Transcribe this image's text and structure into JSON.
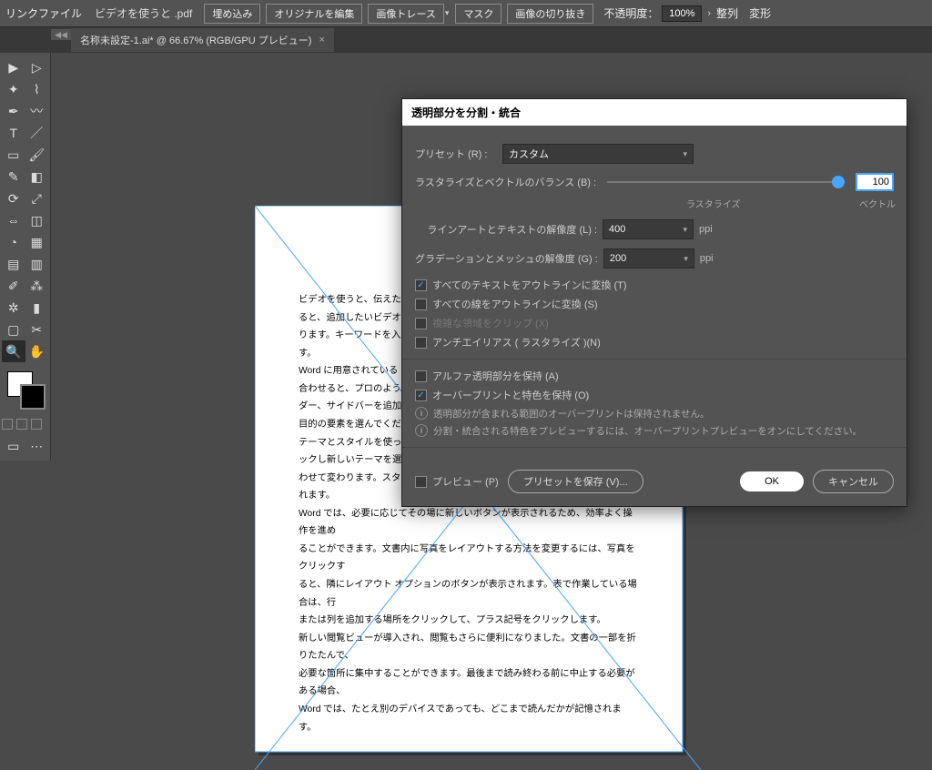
{
  "topbar": {
    "link_file": "リンクファイル",
    "filename": "ビデオを使うと .pdf",
    "embed": "埋め込み",
    "edit_original": "オリジナルを編集",
    "image_trace": "画像トレース",
    "mask": "マスク",
    "crop_image": "画像の切り抜き",
    "opacity_label": "不透明度：",
    "opacity_value": "100%",
    "align": "整列",
    "transform": "変形"
  },
  "tab": {
    "title": "名称未設定-1.ai* @ 66.67% (RGB/GPU プレビュー)"
  },
  "page_text": {
    "l1": "ビデオを使うと、伝えたい",
    "l2": "ると、追加したいビデオを",
    "l3": "ります。キーワードを入力",
    "l4": "す。",
    "l5": "Word に用意されている",
    "l6": "合わせると、プロのような",
    "l7": "ダー、サイドバーを追加",
    "l8": "目的の要素を選んでくだ",
    "l9": "テーマとスタイルを使っ",
    "l10": "ックし新しいテーマを選",
    "l11": "わせて変わります。スタ",
    "l12": "れます。",
    "l13": "Word では、必要に応じてその場に新しいボタンが表示されるため、効率よく操作を進め",
    "l14": "ることができます。文書内に写真をレイアウトする方法を変更するには、写真をクリックす",
    "l15": "ると、隣にレイアウト オプションのボタンが表示されます。表で作業している場合は、行",
    "l16": "または列を追加する場所をクリックして、プラス記号をクリックします。",
    "l17": "新しい閲覧ビューが導入され、閲覧もさらに便利になりました。文書の一部を折りたたんで、",
    "l18": "必要な箇所に集中することができます。最後まで読み終わる前に中止する必要がある場合、",
    "l19": "Word では、たとえ別のデバイスであっても、どこまで読んだかが記憶されます。"
  },
  "dialog": {
    "title": "透明部分を分割・統合",
    "preset_label": "プリセット (R) :",
    "preset_value": "カスタム",
    "balance_label": "ラスタライズとベクトルのバランス (B) :",
    "balance_value": "100",
    "balance_left": "ラスタライズ",
    "balance_right": "ベクトル",
    "lineart_label": "ラインアートとテキストの解像度 (L) :",
    "lineart_value": "400",
    "gradient_label": "グラデーションとメッシュの解像度 (G) :",
    "gradient_value": "200",
    "ppi": "ppi",
    "chk_text_outline": "すべてのテキストをアウトラインに変換 (T)",
    "chk_stroke_outline": "すべての線をアウトラインに変換 (S)",
    "chk_clip": "複雑な領域をクリップ (X)",
    "chk_antialias": "アンチエイリアス ( ラスタライズ )(N)",
    "chk_alpha": "アルファ透明部分を保持 (A)",
    "chk_overprint": "オーバープリントと特色を保持 (O)",
    "info1": "透明部分が含まれる範囲のオーバープリントは保持されません。",
    "info2": "分割・統合される特色をプレビューするには、オーバープリントプレビューをオンにしてください。",
    "preview": "プレビュー (P)",
    "save_preset": "プリセットを保存 (V)...",
    "ok": "OK",
    "cancel": "キャンセル"
  }
}
